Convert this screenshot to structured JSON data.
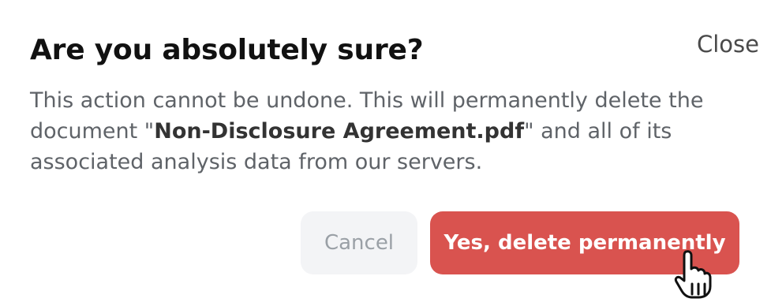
{
  "dialog": {
    "close_label": "Close",
    "title": "Are you absolutely sure?",
    "description": {
      "prefix": "This action cannot be undone. This will permanently delete the document \"",
      "filename": "Non-Disclosure Agreement.pdf",
      "suffix": "\" and all of its associated analysis data from our servers."
    },
    "cancel_label": "Cancel",
    "confirm_label": "Yes, delete permanently"
  },
  "colors": {
    "danger": "#d9534f",
    "cancel_bg": "#f3f4f6",
    "muted_text": "#5f6368"
  },
  "icons": {
    "pointer": "hand-pointer-icon"
  }
}
